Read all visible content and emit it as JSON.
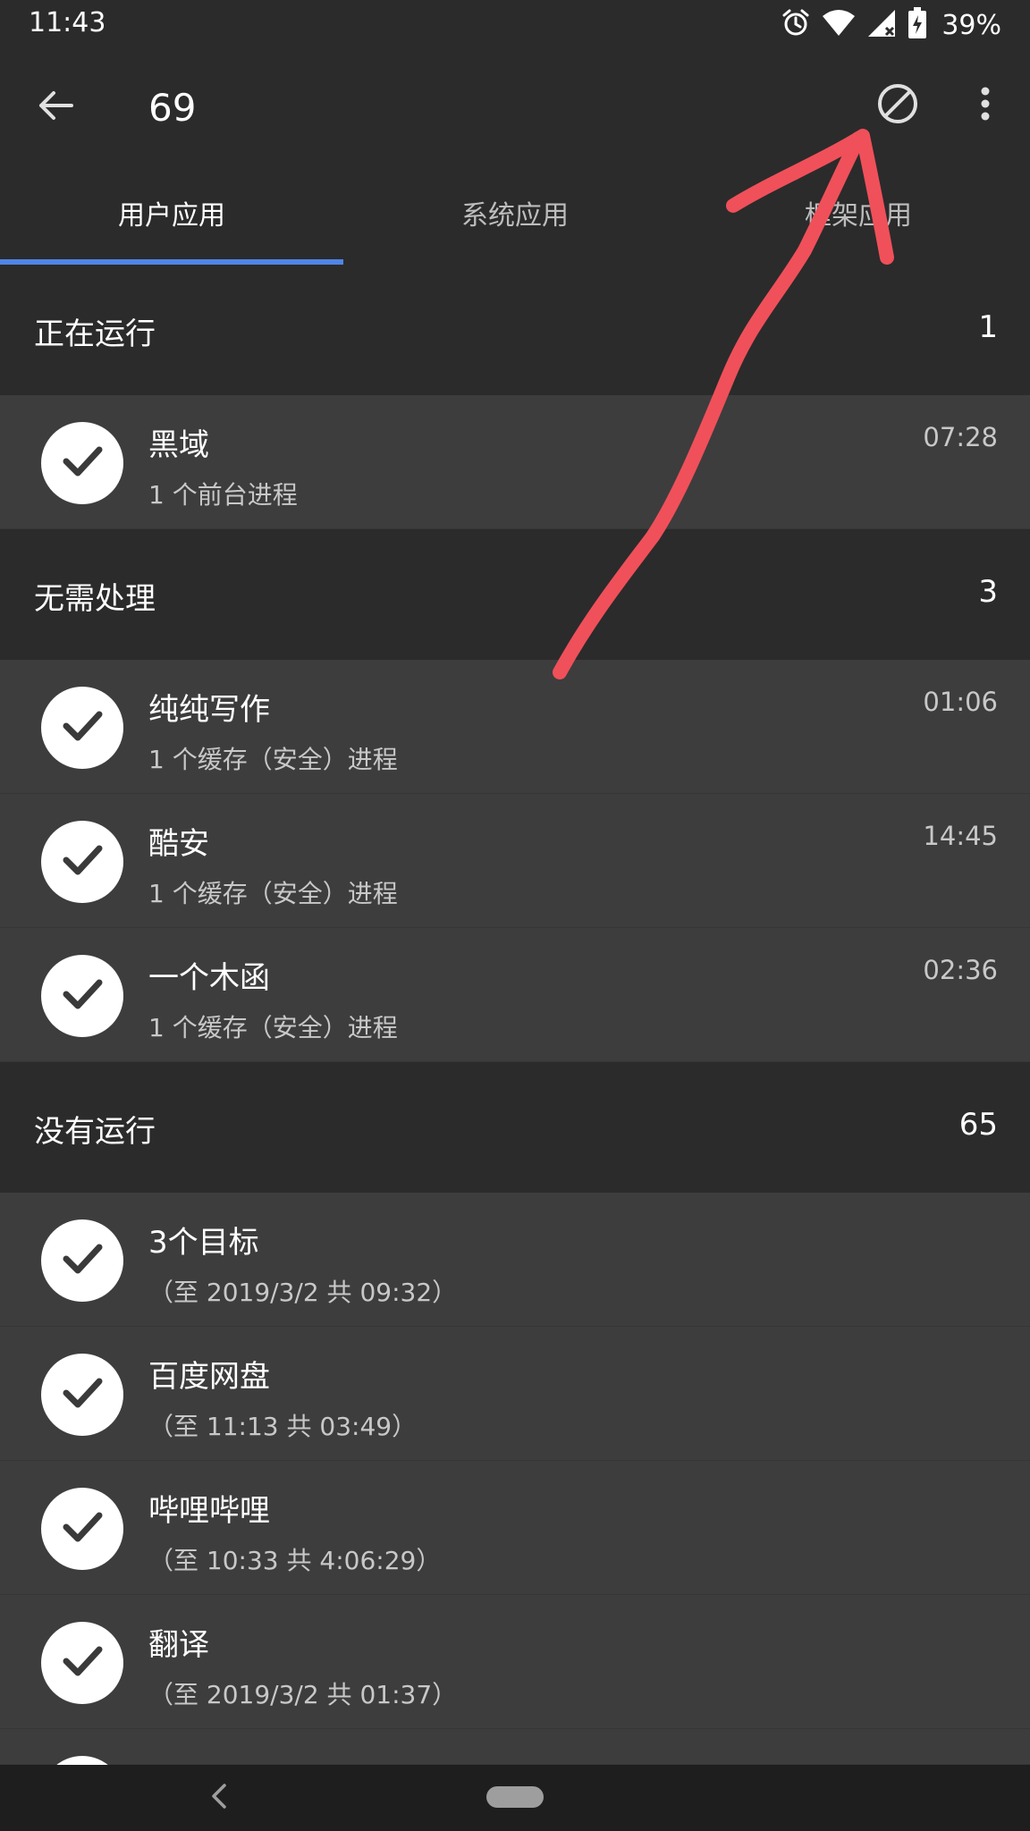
{
  "status_bar": {
    "time": "11:43",
    "battery_percent": "39%",
    "icons": [
      "alarm-icon",
      "wifi-icon",
      "cell-signal-no-data-icon",
      "battery-charging-icon"
    ]
  },
  "app_bar": {
    "title": "69",
    "back_icon": "arrow-left-icon",
    "block_icon": "block-icon",
    "more_icon": "more-vert-icon"
  },
  "tabs": [
    {
      "label": "用户应用",
      "active": true
    },
    {
      "label": "系统应用",
      "active": false
    },
    {
      "label": "框架应用",
      "active": false
    }
  ],
  "sections": [
    {
      "title": "正在运行",
      "count": "1",
      "items": [
        {
          "name": "黑域",
          "subtitle": "1 个前台进程",
          "time": "07:28"
        }
      ]
    },
    {
      "title": "无需处理",
      "count": "3",
      "items": [
        {
          "name": "纯纯写作",
          "subtitle": "1 个缓存（安全）进程",
          "time": "01:06"
        },
        {
          "name": "酷安",
          "subtitle": "1 个缓存（安全）进程",
          "time": "14:45"
        },
        {
          "name": "一个木函",
          "subtitle": "1 个缓存（安全）进程",
          "time": "02:36"
        }
      ]
    },
    {
      "title": "没有运行",
      "count": "65",
      "items": [
        {
          "name": "3个目标",
          "subtitle": "（至 2019/3/2 共 09:32）",
          "time": ""
        },
        {
          "name": "百度网盘",
          "subtitle": "（至 11:13 共 03:49）",
          "time": ""
        },
        {
          "name": "哔哩哔哩",
          "subtitle": "（至 10:33 共 4:06:29）",
          "time": ""
        },
        {
          "name": "翻译",
          "subtitle": "（至 2019/3/2 共 01:37）",
          "time": ""
        }
      ]
    }
  ],
  "colors": {
    "background": "#2b2b2b",
    "row_background": "#3d3d3d",
    "tab_indicator": "#4f86e8",
    "annotation": "#f0505a"
  }
}
